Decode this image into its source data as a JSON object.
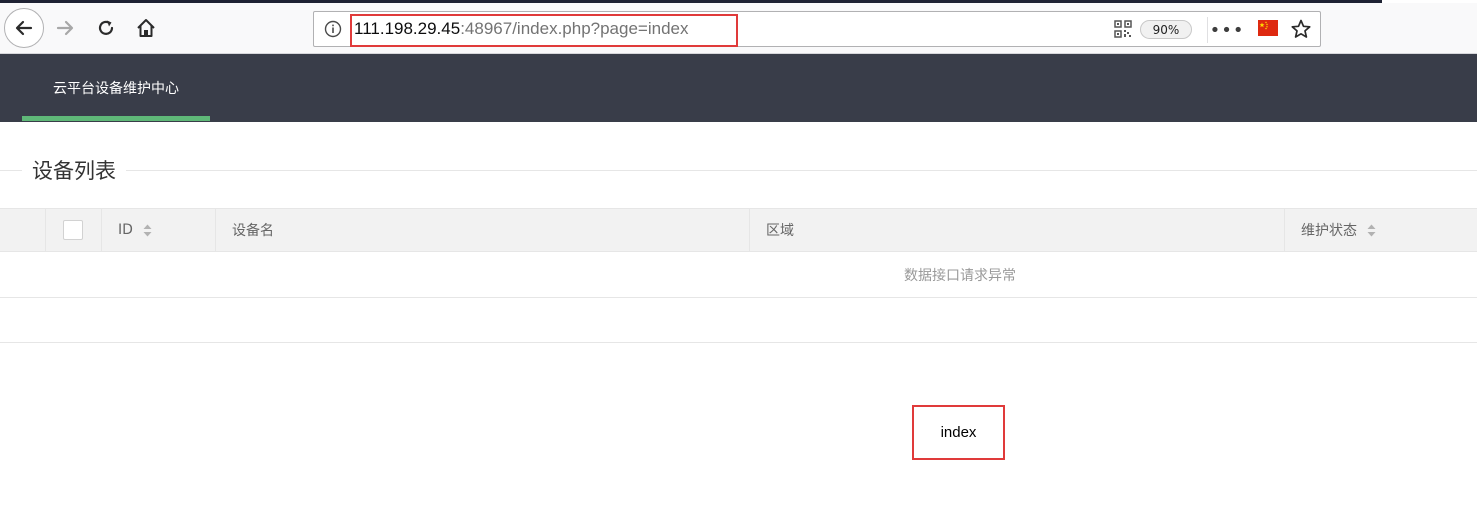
{
  "browser": {
    "url_host": "111.198.29.45",
    "url_rest": ":48967/index.php?page=index",
    "zoom": "90%",
    "more_glyph": "•••",
    "icons": [
      "back-icon",
      "forward-icon",
      "reload-icon",
      "home-icon",
      "info-icon",
      "qr-code-icon",
      "more-icon",
      "china-flag-icon",
      "bookmark-star-icon"
    ]
  },
  "header": {
    "title": "云平台设备维护中心",
    "accent_color": "#5fb878",
    "bg_color": "#393d49"
  },
  "section": {
    "legend": "设备列表"
  },
  "table": {
    "columns": [
      {
        "key": "checkbox",
        "label": ""
      },
      {
        "key": "id",
        "label": "ID",
        "sortable": true
      },
      {
        "key": "name",
        "label": "设备名",
        "sortable": false
      },
      {
        "key": "area",
        "label": "区域",
        "sortable": false
      },
      {
        "key": "status",
        "label": "维护状态",
        "sortable": true
      }
    ],
    "empty_message": "数据接口请求异常"
  },
  "output": {
    "text": "index"
  }
}
